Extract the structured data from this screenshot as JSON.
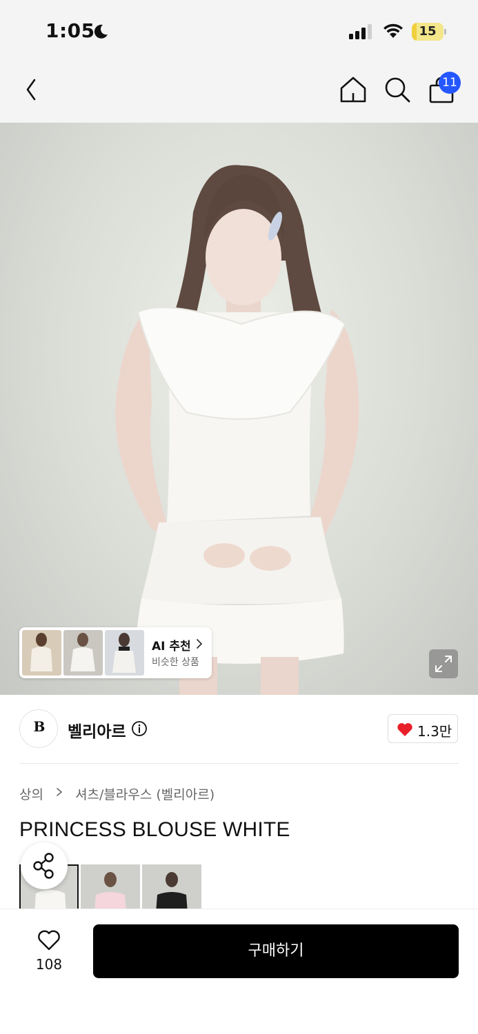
{
  "status_bar": {
    "time": "1:05",
    "battery_level": 15,
    "battery_label": "15",
    "icons": [
      "moon-icon",
      "cellular-signal-icon",
      "wifi-icon",
      "battery-icon"
    ]
  },
  "nav": {
    "cart_count": "11",
    "icons": [
      "back-arrow-icon",
      "home-icon",
      "search-icon",
      "shopping-bag-icon"
    ]
  },
  "ai_recommend": {
    "title": "AI 추천",
    "subtitle": "비슷한 상품"
  },
  "brand": {
    "logo_text": "B",
    "name": "벨리아르",
    "likes": "1.3만"
  },
  "breadcrumb": {
    "category": "상의",
    "subcategory": "셔츠/블라우스 (벨리아르)"
  },
  "product": {
    "title": "PRINCESS BLOUSE WHITE"
  },
  "bottom_bar": {
    "wish_count": "108",
    "buy_label": "구매하기"
  },
  "colors": {
    "accent_blue": "#2557ff",
    "heart_red": "#e8202a",
    "buy_button": "#000000",
    "battery_yellow": "#f0cf3e"
  }
}
